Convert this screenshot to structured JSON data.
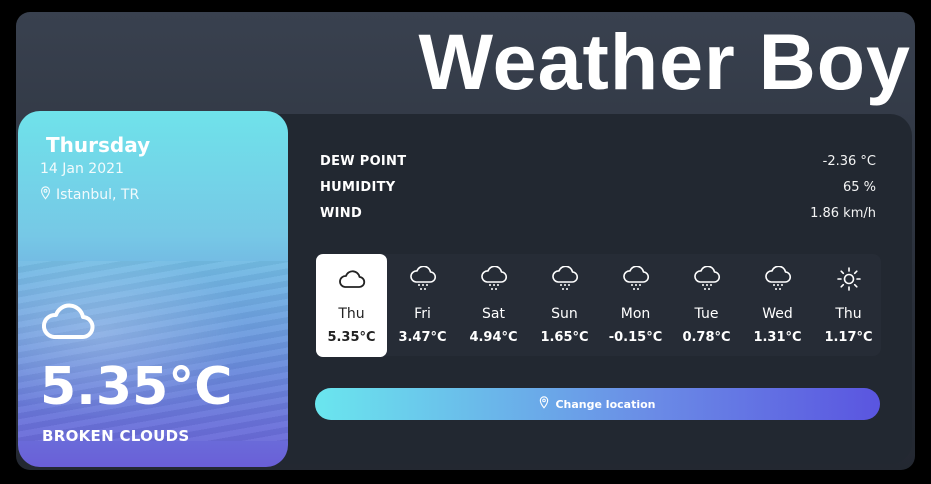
{
  "app": {
    "title": "Weather Boy"
  },
  "current": {
    "day": "Thursday",
    "date": "14 Jan 2021",
    "location": "Istanbul, TR",
    "temperature": "5.35°C",
    "description": "BROKEN CLOUDS",
    "icon": "cloud-icon"
  },
  "stats": [
    {
      "label": "DEW POINT",
      "value": "-2.36 °C"
    },
    {
      "label": "HUMIDITY",
      "value": "65 %"
    },
    {
      "label": "WIND",
      "value": "1.86 km/h"
    }
  ],
  "forecast": [
    {
      "day": "Thu",
      "temp": "5.35°C",
      "icon": "cloud-icon",
      "active": true
    },
    {
      "day": "Fri",
      "temp": "3.47°C",
      "icon": "snow-cloud-icon"
    },
    {
      "day": "Sat",
      "temp": "4.94°C",
      "icon": "snow-cloud-icon"
    },
    {
      "day": "Sun",
      "temp": "1.65°C",
      "icon": "snow-cloud-icon"
    },
    {
      "day": "Mon",
      "temp": "-0.15°C",
      "icon": "snow-cloud-icon"
    },
    {
      "day": "Tue",
      "temp": "0.78°C",
      "icon": "snow-cloud-icon"
    },
    {
      "day": "Wed",
      "temp": "1.31°C",
      "icon": "snow-cloud-icon"
    },
    {
      "day": "Thu",
      "temp": "1.17°C",
      "icon": "sun-icon"
    }
  ],
  "actions": {
    "change_location": "Change location"
  },
  "colors": {
    "accent_start": "#6ae6ee",
    "accent_end": "#5a55e0",
    "panel": "#222831"
  }
}
